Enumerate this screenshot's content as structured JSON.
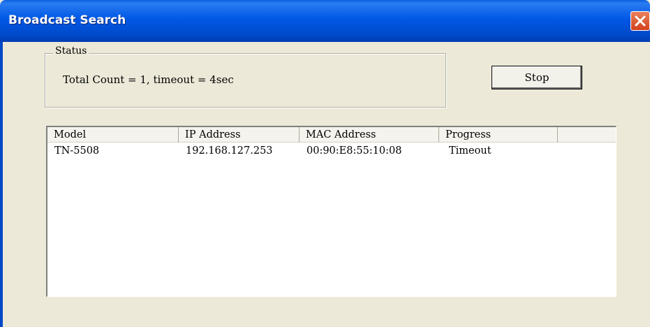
{
  "window": {
    "title": "Broadcast Search"
  },
  "status": {
    "group_label": "Status",
    "text": "Total Count = 1, timeout = 4sec"
  },
  "buttons": {
    "stop_label": "Stop"
  },
  "table": {
    "headers": {
      "model": "Model",
      "ip": "IP Address",
      "mac": "MAC Address",
      "progress": "Progress"
    },
    "rows": [
      {
        "model": "TN-5508",
        "ip": "192.168.127.253",
        "mac": "00:90:E8:55:10:08",
        "progress": "Timeout"
      }
    ]
  },
  "icons": {
    "close": "close-icon"
  },
  "colors": {
    "titlebar": "#0058e6",
    "close_button": "#d2411c",
    "dialog_background": "#ece9d8"
  }
}
